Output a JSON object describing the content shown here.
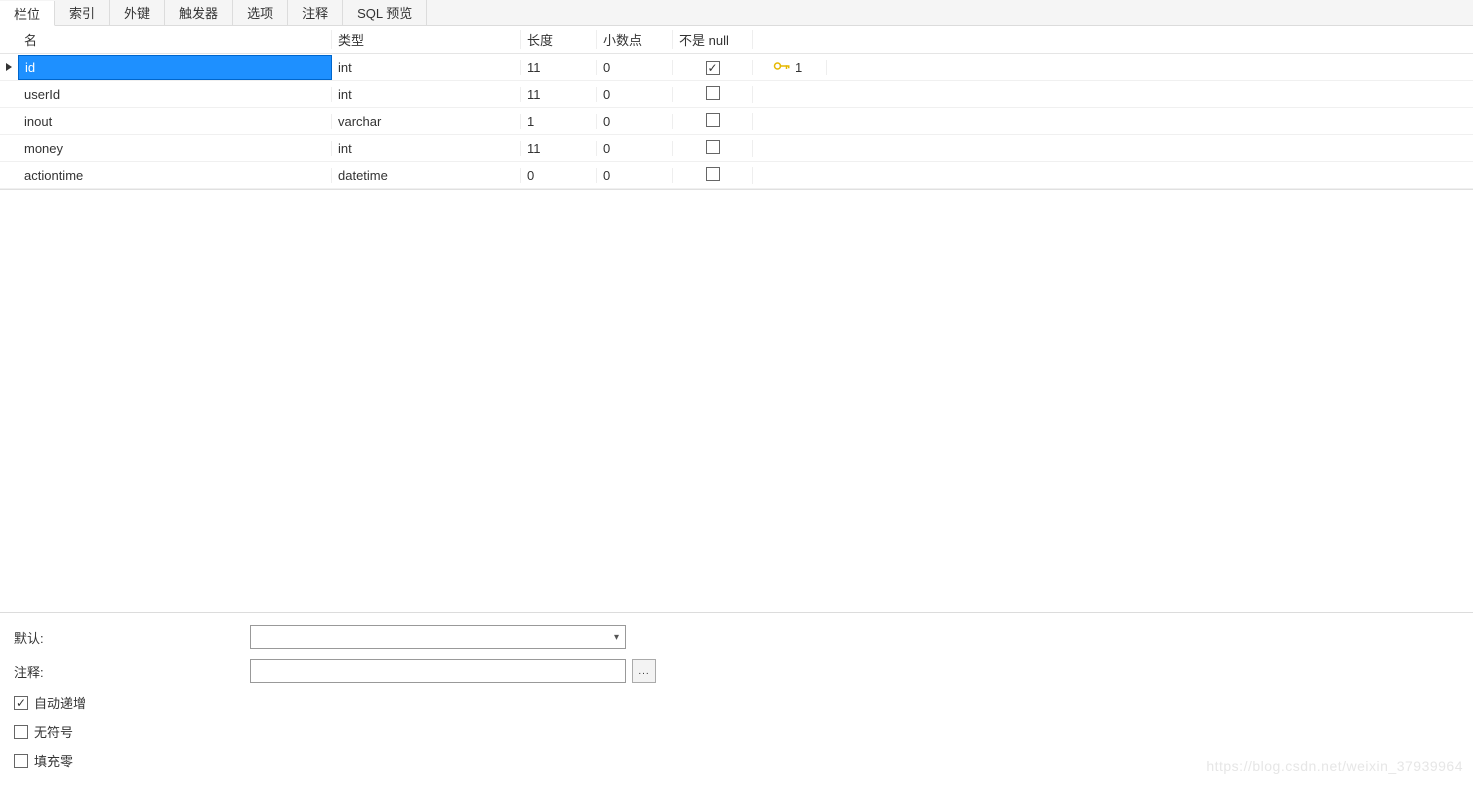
{
  "tabs": {
    "items": [
      {
        "label": "栏位",
        "active": true
      },
      {
        "label": "索引",
        "active": false
      },
      {
        "label": "外键",
        "active": false
      },
      {
        "label": "触发器",
        "active": false
      },
      {
        "label": "选项",
        "active": false
      },
      {
        "label": "注释",
        "active": false
      },
      {
        "label": "SQL 预览",
        "active": false
      }
    ]
  },
  "grid": {
    "headers": {
      "name": "名",
      "type": "类型",
      "length": "长度",
      "decimal": "小数点",
      "notnull": "不是 null"
    },
    "rows": [
      {
        "name": "id",
        "type": "int",
        "length": "11",
        "decimal": "0",
        "notnull": true,
        "pk": true,
        "pkIndex": "1",
        "selected": true
      },
      {
        "name": "userId",
        "type": "int",
        "length": "11",
        "decimal": "0",
        "notnull": false,
        "pk": false,
        "pkIndex": "",
        "selected": false
      },
      {
        "name": "inout",
        "type": "varchar",
        "length": "1",
        "decimal": "0",
        "notnull": false,
        "pk": false,
        "pkIndex": "",
        "selected": false
      },
      {
        "name": "money",
        "type": "int",
        "length": "11",
        "decimal": "0",
        "notnull": false,
        "pk": false,
        "pkIndex": "",
        "selected": false
      },
      {
        "name": "actiontime",
        "type": "datetime",
        "length": "0",
        "decimal": "0",
        "notnull": false,
        "pk": false,
        "pkIndex": "",
        "selected": false
      }
    ]
  },
  "bottom": {
    "defaultLabel": "默认:",
    "defaultValue": "",
    "commentLabel": "注释:",
    "commentValue": "",
    "moreBtn": "...",
    "autoIncrement": {
      "label": "自动递增",
      "checked": true
    },
    "unsigned": {
      "label": "无符号",
      "checked": false
    },
    "zerofill": {
      "label": "填充零",
      "checked": false
    }
  },
  "watermark": "https://blog.csdn.net/weixin_37939964"
}
